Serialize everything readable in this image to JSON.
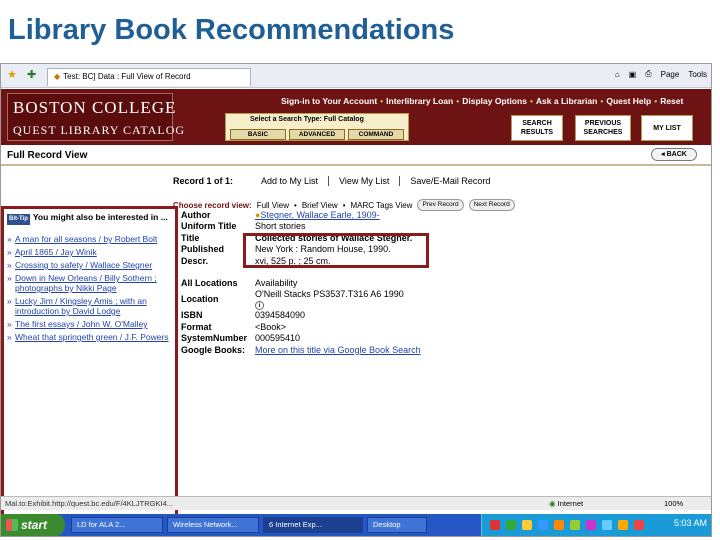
{
  "slide_title": "Library Book Recommendations",
  "browser": {
    "tab_title": "Test: BC] Data : Full View of Record",
    "tools": [
      "Page",
      "Tools"
    ]
  },
  "banner": {
    "logo_line1": "BOSTON COLLEGE",
    "logo_line2": "QUEST LIBRARY CATALOG",
    "top_nav": [
      "Sign-in to Your Account",
      "Interlibrary Loan",
      "Display Options",
      "Ask a Librarian",
      "Quest Help",
      "Reset"
    ],
    "search_type_label": "Select a Search Type: Full Catalog",
    "search_types": [
      "BASIC",
      "ADVANCED",
      "COMMAND"
    ],
    "search_results": "SEARCH RESULTS",
    "previous_searches": "PREVIOUS SEARCHES",
    "my_list": "MY LIST"
  },
  "record_header": {
    "title": "Full Record View",
    "back": "BACK"
  },
  "record_nav": {
    "count": "Record 1 of 1:",
    "links": [
      "Add to My List",
      "View My List",
      "Save/E-Mail Record"
    ]
  },
  "view_bar": {
    "label": "Choose record view:",
    "full": "Full View",
    "brief": "Brief View",
    "marc": "MARC Tags View",
    "prev": "Prev Record",
    "next": "Next Record"
  },
  "sidebar": {
    "bittip": "Bit-Tip",
    "heading": "You might also be interested in ...",
    "items": [
      "A man for all seasons / by Robert Bolt",
      "April 1865 / Jay Winik",
      "Crossing to safety / Wallace Stegner",
      "Down in New Orleans / Billy Sothern ; photographs by Nikki Page",
      "Lucky Jim / Kingsley Amis ; with an introduction by David Lodge",
      "The first essays / John W. O'Malley",
      "Wheat that springeth green / J.F. Powers"
    ]
  },
  "record": {
    "author_label": "Author",
    "author": "Stegner, Wallace Earle, 1909-",
    "uniform_label": "Uniform Title",
    "uniform": "Short stories",
    "title_label": "Title",
    "title": "Collected stories of Wallace Stegner.",
    "published_label": "Published",
    "published": "New York : Random House, 1990.",
    "descr_label": "Descr.",
    "descr": "xvi, 525 p. ; 25 cm.",
    "locations_label": "All Locations",
    "availability": "Availability",
    "location_label": "Location",
    "location": "O'Neill Stacks PS3537.T316 A6 1990",
    "isbn_label": "ISBN",
    "isbn": "0394584090",
    "format_label": "Format",
    "format": "<Book>",
    "sysnum_label": "SystemNumber",
    "sysnum": "000595410",
    "google_label": "Google Books:",
    "google": "More on this title via Google Book Search"
  },
  "status_bar": {
    "url": "Mal.to:Exhibit.http://quest.bc.edu/F/4KLJTRGKI4...",
    "zone": "Internet",
    "zoom": "100%"
  },
  "taskbar": {
    "start": "start",
    "tasks": [
      "LD for ALA 2...",
      "Wireless Network...",
      "6 Internet Exp...",
      "Desktop"
    ],
    "clock": "5:03 AM"
  },
  "colors": {
    "banner": "#6e1313",
    "highlight": "#8b1a1a",
    "link": "#2244aa",
    "title": "#1f5f96"
  }
}
